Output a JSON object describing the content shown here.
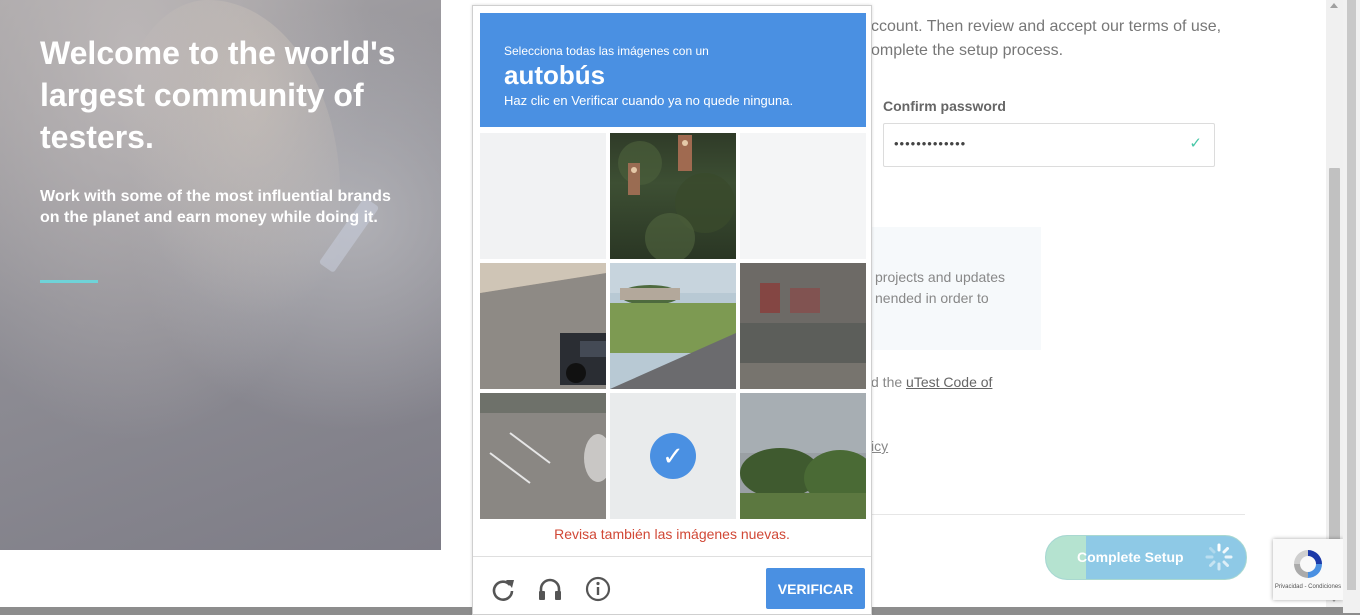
{
  "hero": {
    "title": "Welcome to the world's largest community of testers.",
    "subtitle": "Work with some of the most influential brands on the planet and earn money while doing it."
  },
  "form": {
    "intro_text": "ccount. Then review and accept our terms of use, omplete the setup process.",
    "confirm_password_label": "Confirm password",
    "confirm_password_value": "•••••••••••••",
    "info_line1": "projects and updates",
    "info_line2": "nended in order to",
    "agree_prefix": "d the ",
    "agree_link": "uTest Code of",
    "privacy_fragment": "icy",
    "complete_button": "Complete Setup",
    "complete_progress": 0.2
  },
  "captcha": {
    "instruction_top": "Selecciona todas las imágenes con un",
    "target_word": "autobús",
    "instruction_bottom": "Haz clic en Verificar cuando ya no quede ninguna.",
    "warning": "Revisa también las imágenes nuevas.",
    "verify_label": "VERIFICAR",
    "tiles": [
      {
        "state": "loading"
      },
      {
        "state": "image"
      },
      {
        "state": "selected-fading"
      },
      {
        "state": "image"
      },
      {
        "state": "image"
      },
      {
        "state": "image"
      },
      {
        "state": "image"
      },
      {
        "state": "selected"
      },
      {
        "state": "image"
      }
    ],
    "footer_icons": [
      "reload-icon",
      "audio-icon",
      "info-icon"
    ]
  },
  "recaptcha_badge": {
    "footer_text": "Privacidad - Condiciones"
  },
  "colors": {
    "captcha_blue": "#4a90e2",
    "warning_red": "#d14836",
    "accent_teal": "#6fd3d8",
    "check_green": "#48c7a7"
  }
}
